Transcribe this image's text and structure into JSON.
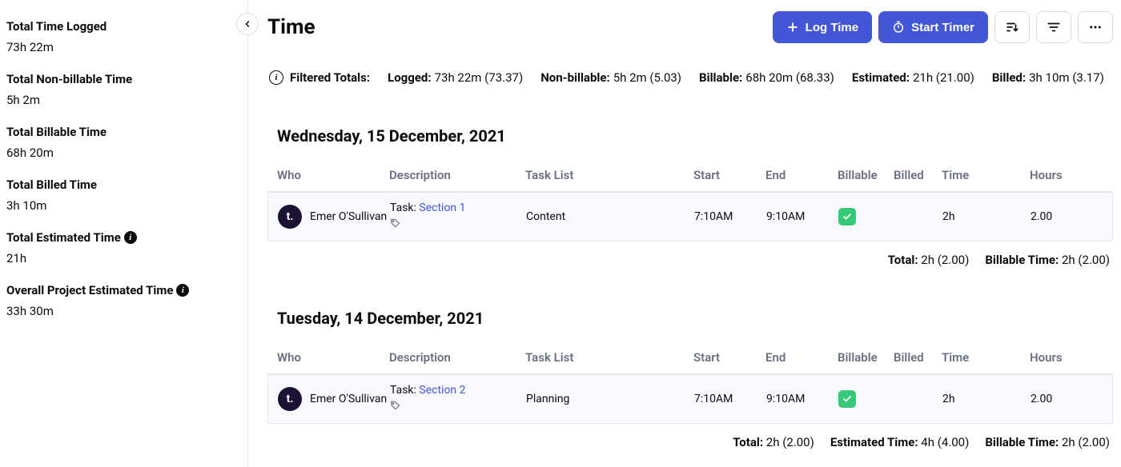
{
  "sidebar": {
    "stats": [
      {
        "label": "Total Time Logged",
        "value": "73h 22m",
        "info": false
      },
      {
        "label": "Total Non-billable Time",
        "value": "5h 2m",
        "info": false
      },
      {
        "label": "Total Billable Time",
        "value": "68h 20m",
        "info": false
      },
      {
        "label": "Total Billed Time",
        "value": "3h 10m",
        "info": false
      },
      {
        "label": "Total Estimated Time",
        "value": "21h",
        "info": true
      },
      {
        "label": "Overall Project Estimated Time",
        "value": "33h 30m",
        "info": true
      }
    ]
  },
  "page": {
    "title": "Time"
  },
  "toolbar": {
    "log_time": "Log Time",
    "start_timer": "Start Timer"
  },
  "filtered_totals": {
    "lead": "Filtered Totals:",
    "logged_label": "Logged:",
    "logged_value": "73h 22m (73.37)",
    "nonbill_label": "Non-billable:",
    "nonbill_value": "5h 2m (5.03)",
    "bill_label": "Billable:",
    "bill_value": "68h 20m (68.33)",
    "est_label": "Estimated:",
    "est_value": "21h (21.00)",
    "billed_label": "Billed:",
    "billed_value": "3h 10m (3.17)"
  },
  "columns": {
    "who": "Who",
    "description": "Description",
    "task_list": "Task List",
    "start": "Start",
    "end": "End",
    "billable": "Billable",
    "billed": "Billed",
    "time": "Time",
    "hours": "Hours"
  },
  "task_prefix": "Task: ",
  "days": [
    {
      "heading": "Wednesday, 15 December, 2021",
      "row": {
        "who": "Emer O'Sullivan",
        "task_link": "Section 1",
        "task_list": "Content",
        "start": "7:10AM",
        "end": "9:10AM",
        "time": "2h",
        "hours": "2.00"
      },
      "totals": [
        {
          "label": "Total:",
          "value": "2h (2.00)"
        },
        {
          "label": "Billable Time:",
          "value": "2h (2.00)"
        }
      ]
    },
    {
      "heading": "Tuesday, 14 December, 2021",
      "row": {
        "who": "Emer O'Sullivan",
        "task_link": "Section 2",
        "task_list": "Planning",
        "start": "7:10AM",
        "end": "9:10AM",
        "time": "2h",
        "hours": "2.00"
      },
      "totals": [
        {
          "label": "Total:",
          "value": "2h (2.00)"
        },
        {
          "label": "Estimated Time:",
          "value": "4h (4.00)"
        },
        {
          "label": "Billable Time:",
          "value": "2h (2.00)"
        }
      ]
    }
  ]
}
